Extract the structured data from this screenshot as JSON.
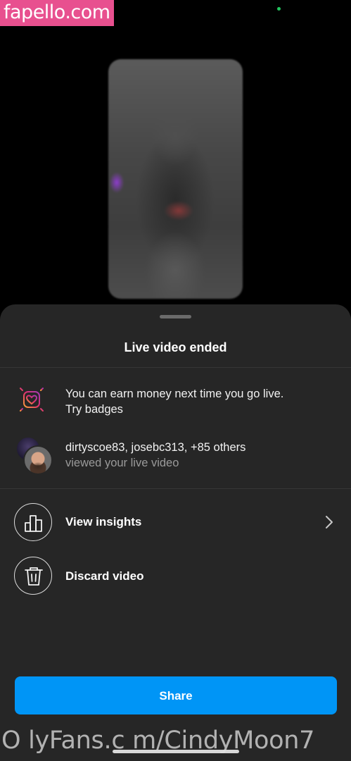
{
  "watermark": {
    "top_text": "fapello.com",
    "bottom_text": "O lyFans.c m/CindyMoon7"
  },
  "sheet": {
    "title": "Live video ended",
    "badges_row": {
      "line1": "You can earn money next time you go live.",
      "line2": "Try badges",
      "icon": "badge-heart-icon"
    },
    "viewers_row": {
      "line1": "dirtyscoe83, josebc313, +85 others",
      "line2": "viewed your live video"
    },
    "actions": [
      {
        "label": "View insights",
        "icon": "bar-chart-icon"
      },
      {
        "label": "Discard video",
        "icon": "trash-icon"
      }
    ],
    "share_label": "Share"
  },
  "colors": {
    "sheet_background": "#262626",
    "share_button": "#0095f6",
    "watermark_pink": "#e8508f"
  }
}
